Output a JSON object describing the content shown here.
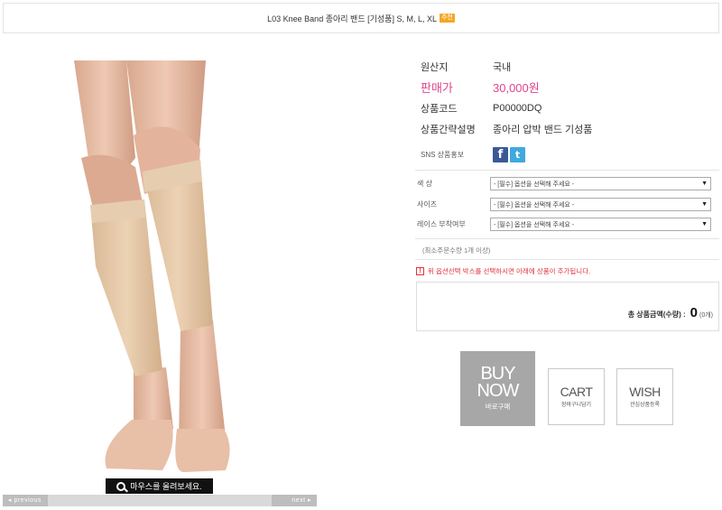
{
  "product": {
    "title": "L03 Knee Band 종아리 밴드 [기성품] S, M, L, XL",
    "badge": "추천"
  },
  "image": {
    "zoom_hint": "마우스를 올려보세요.",
    "prev_label": "◂ previous",
    "next_label": "next ▸"
  },
  "info": {
    "origin_label": "원산지",
    "origin_value": "국내",
    "price_label": "판매가",
    "price_value": "30,000원",
    "code_label": "상품코드",
    "code_value": "P00000DQ",
    "desc_label": "상품간략설명",
    "desc_value": "종아리 압박 밴드 기성품",
    "sns_label": "SNS 상품홍보",
    "sns_facebook": "f",
    "sns_twitter": "t"
  },
  "options": [
    {
      "label": "색 상",
      "selected": "- [필수] 옵션을 선택해 주세요 -"
    },
    {
      "label": "사이즈",
      "selected": "- [필수] 옵션을 선택해 주세요 -"
    },
    {
      "label": "레이스 부착여부",
      "selected": "- [필수] 옵션을 선택해 주세요 -"
    }
  ],
  "min_qty": "(최소주문수량 1개 이상)",
  "notice": {
    "icon": "!",
    "text": "위 옵션선택 박스를 선택하시면 아래에 상품이 추가됩니다."
  },
  "total": {
    "label": "총 상품금액(수량) :",
    "amount": "0",
    "count": "(0개)"
  },
  "buttons": {
    "buy_line1": "BUY",
    "buy_line2": "NOW",
    "buy_sub": "바로구매",
    "cart_main": "CART",
    "cart_sub": "장바구니담기",
    "wish_main": "WISH",
    "wish_sub": "관심상품등록"
  },
  "colors": {
    "price": "#e0458c",
    "badge": "#f5a623",
    "buy_bg": "#a7a7a7",
    "facebook": "#3b5998",
    "twitter": "#3fa9e0",
    "notice": "#e0333a"
  }
}
